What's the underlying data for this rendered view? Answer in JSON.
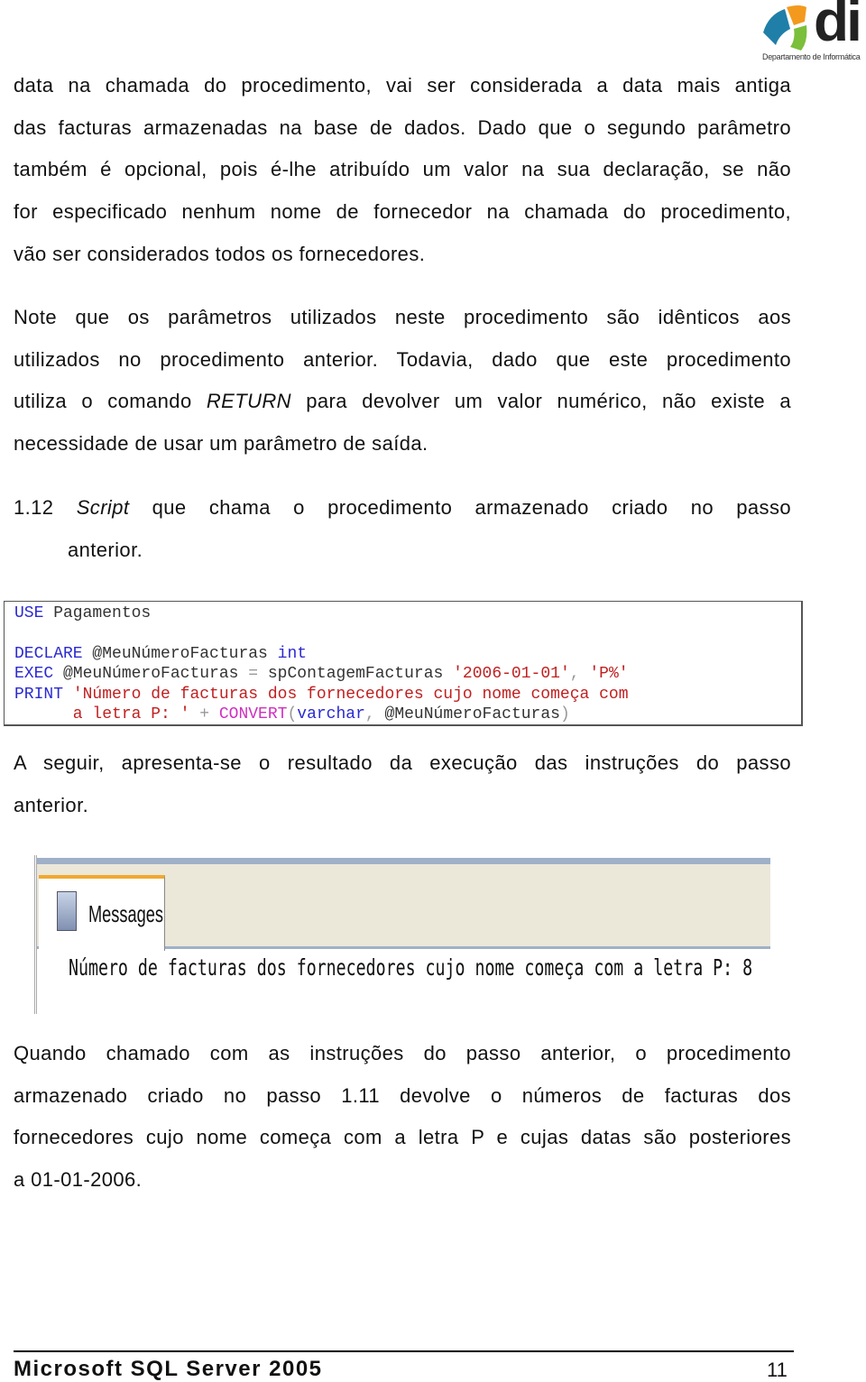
{
  "header": {
    "logo_text": "di",
    "logo_subtitle": "Departamento de Informática"
  },
  "paragraph1": [
    "data na chamada do procedimento, vai ser considerada a data mais antiga",
    "das facturas armazenadas na base de dados. Dado que o segundo parâmetro",
    "também é opcional, pois é-lhe atribuído um valor na sua declaração, se não",
    "for especificado nenhum nome de fornecedor na chamada do procedimento,",
    "vão ser considerados todos os fornecedores."
  ],
  "paragraph2": {
    "line1": "Note que os parâmetros utilizados neste procedimento são idênticos aos",
    "line2": "utilizados no procedimento anterior. Todavia, dado que este procedimento",
    "line3_pre": "utiliza o comando ",
    "line3_em": "RETURN",
    "line3_post": " para devolver um valor numérico, não existe a",
    "line4": "necessidade de usar um parâmetro de saída."
  },
  "heading": {
    "number": "1.12",
    "em": "Script",
    "rest": " que chama o procedimento armazenado criado no passo",
    "line2": "anterior."
  },
  "code": {
    "l1_kw": "USE",
    "l1_rest": " Pagamentos",
    "l2_kw": "DECLARE",
    "l2_var": " @MeuNúmeroFacturas ",
    "l2_type": "int",
    "l3_kw": "EXEC",
    "l3_var": " @MeuNúmeroFacturas ",
    "l3_op": "=",
    "l3_proc": " spContagemFacturas ",
    "l3_s1": "'2006-01-01'",
    "l3_comma": ", ",
    "l3_s2": "'P%'",
    "l4_kw": "PRINT",
    "l4_str": " 'Número de facturas dos fornecedores cujo nome começa com",
    "l5_str": "      a letra P: '",
    "l5_op": " + ",
    "l5_fn": "CONVERT",
    "l5_p1": "(",
    "l5_type": "varchar",
    "l5_comma": ", ",
    "l5_var": "@MeuNúmeroFacturas",
    "l5_p2": ")"
  },
  "paragraph3": [
    "A seguir, apresenta-se o resultado da execução das instruções do passo",
    "anterior."
  ],
  "messages_panel": {
    "tab_label": "Messages",
    "output": "Número de facturas dos fornecedores cujo nome começa com a letra P: 8"
  },
  "paragraph4": [
    "Quando chamado com as instruções do passo anterior, o procedimento",
    "armazenado criado no passo 1.11 devolve o números de facturas dos",
    "fornecedores cujo nome começa com a letra P e cujas datas são posteriores",
    "a 01-01-2006."
  ],
  "footer": {
    "title": "Microsoft SQL Server 2005",
    "page": "11"
  }
}
